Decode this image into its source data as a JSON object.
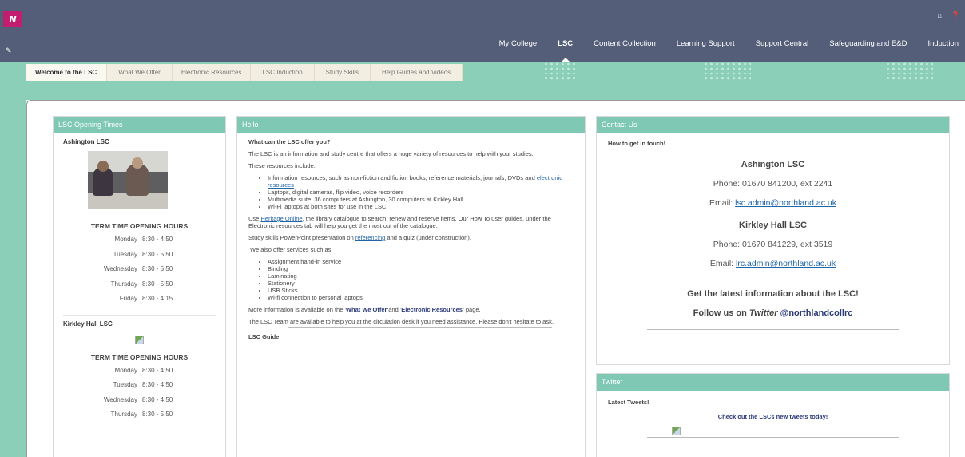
{
  "header": {
    "logo_text": "N",
    "icons": [
      "home-icon",
      "help-icon"
    ],
    "nav": [
      "My College",
      "LSC",
      "Content Collection",
      "Learning Support",
      "Support Central",
      "Safeguarding and E&D",
      "Induction"
    ],
    "active_nav": "LSC"
  },
  "subnav": {
    "tabs": [
      "Welcome to the LSC",
      "What We Offer",
      "Electronic Resources",
      "LSC Induction",
      "Study Skills",
      "Help Guides and Videos"
    ],
    "active": "Welcome to the LSC"
  },
  "opening": {
    "header": "LSC Opening Times",
    "ashington": {
      "title": "Ashington LSC",
      "hours_title": "TERM TIME OPENING HOURS",
      "rows": [
        {
          "day": "Monday",
          "time": "8:30 - 4:50"
        },
        {
          "day": "Tuesday",
          "time": "8:30 - 5:50"
        },
        {
          "day": "Wednesday",
          "time": "8:30 - 5:50"
        },
        {
          "day": "Thursday",
          "time": "8:30 - 5:50"
        },
        {
          "day": "Friday",
          "time": "8:30 - 4:15"
        }
      ]
    },
    "kirkley": {
      "title": "Kirkley Hall LSC",
      "hours_title": "TERM TIME OPENING HOURS",
      "rows": [
        {
          "day": "Monday",
          "time": "8:30 - 4:50"
        },
        {
          "day": "Tuesday",
          "time": "8:30 - 4:50"
        },
        {
          "day": "Wednesday",
          "time": "8:30 - 4:50"
        },
        {
          "day": "Thursday",
          "time": "8:30 - 5:50"
        }
      ]
    }
  },
  "hello": {
    "header": "Hello",
    "question": "What can the LSC offer you?",
    "intro": "The LSC is an information and study centre that offers a huge variety of resources to help with your studies.",
    "resources_intro": "These resources include:",
    "resource_1_a": "Information resources; such as non-fiction and fiction books, reference materials, journals, DVDs and ",
    "resource_1_link": "electronic resources",
    "resource_2": "Laptops, digital cameras, flip video, voice recorders",
    "resource_3": "Multimedia suite: 36 computers at Ashington, 30 computers at Kirkley Hall",
    "resource_4": "Wi-Fi laptops at both sites for use in the LSC",
    "heritage_a": "Use ",
    "heritage_link": "Heritage Online",
    "heritage_b": ", the library catalogue to search, renew and reserve items. Our How To user guides, under the Electronic resources tab will help you get the most out of the catalogue.",
    "skills_a": "Study skills PowerPoint presentation on ",
    "skills_link": "referencing",
    "skills_b": " and a quiz (under construction).",
    "services_intro": "We also offer services such as:",
    "services": [
      "Assignment hand-in service",
      "Binding",
      "Laminating",
      "Stationery",
      "USB Sticks",
      "Wi-fi connection to personal laptops"
    ],
    "more_a": "More information is available on the '",
    "more_link1": "What We Offer'",
    "more_b": "and '",
    "more_link2": "Electronic Resources'",
    "more_c": " page.",
    "team": "The LSC Team are available to help you at the circulation desk if you need assistance.  Please don't hesitate to ask.",
    "guide": "LSC Guide"
  },
  "contact": {
    "header": "Contact Us",
    "sub": "How to get in touch!",
    "ashington": {
      "name": "Ashington LSC",
      "phone": "Phone: 01670 841200, ext 2241",
      "email_label": "Email: ",
      "email": "lsc.admin@northland.ac.uk"
    },
    "kirkley": {
      "name": "Kirkley Hall LSC",
      "phone": "Phone: 01670 841229, ext 3519",
      "email_label": "Email: ",
      "email": "lrc.admin@northland.ac.uk"
    },
    "latest": "Get the latest information about the LSC!",
    "follow_a": "Follow us on ",
    "follow_twitter": "Twitter",
    "follow_handle": "@northlandcollrc"
  },
  "twitter": {
    "header": "Twitter",
    "label": "Latest Tweets!",
    "cta": "Check out the LSCs new tweets today!"
  }
}
